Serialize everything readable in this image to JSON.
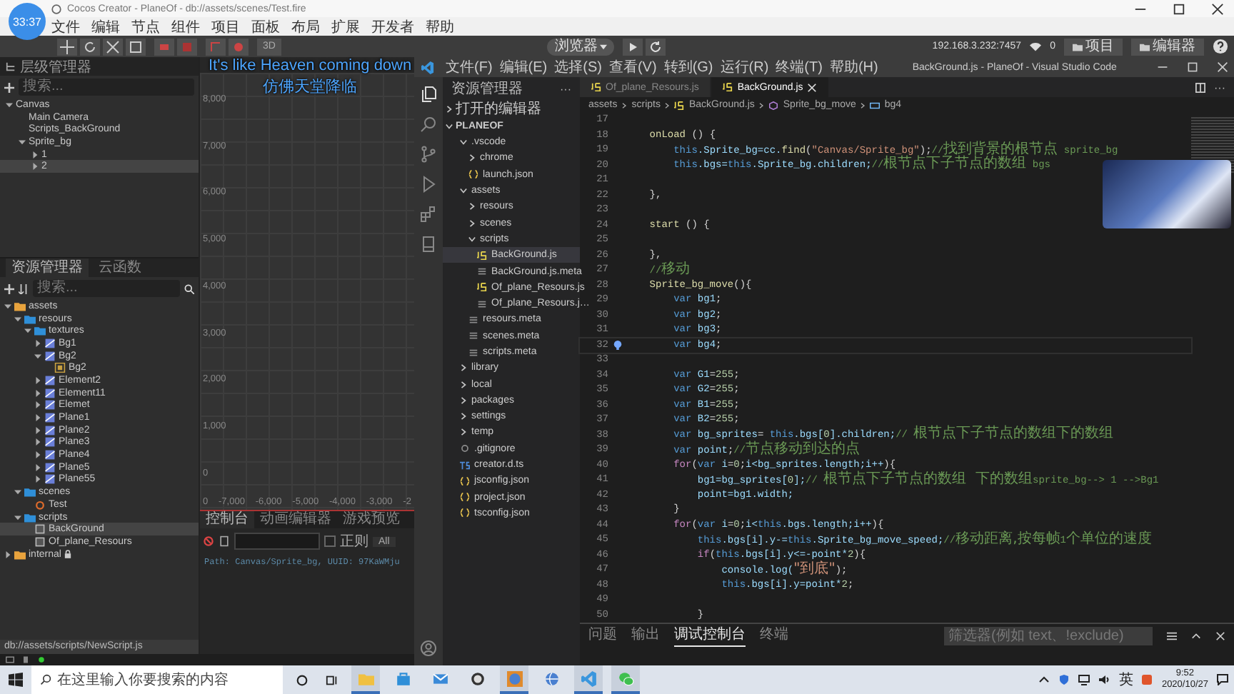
{
  "cocos": {
    "title": "Cocos Creator - PlaneOf - db://assets/scenes/Test.fire",
    "menu": [
      "文件",
      "编辑",
      "节点",
      "组件",
      "项目",
      "面板",
      "布局",
      "扩展",
      "开发者",
      "帮助"
    ],
    "timer": "33:37",
    "toolbar": {
      "mode": "3D",
      "platform": "浏览器",
      "ip": "192.168.3.232:7457",
      "clients": "0",
      "buttons": [
        "项目",
        "编辑器"
      ]
    },
    "hierarchy": {
      "title": "层级管理器",
      "search": {
        "placeholder": "搜索..."
      },
      "items": [
        {
          "name": "Canvas",
          "expanded": true,
          "selected": false,
          "children": [
            {
              "name": "Main Camera",
              "selected": false
            },
            {
              "name": "Scripts_BackGround",
              "selected": false
            },
            {
              "name": "Sprite_bg",
              "expanded": true,
              "selected": false,
              "children": [
                {
                  "name": "1",
                  "expanded": false,
                  "selected": false
                },
                {
                  "name": "2",
                  "expanded": false,
                  "selected": true
                }
              ]
            }
          ]
        }
      ]
    },
    "assets": {
      "tabs": [
        {
          "label": "资源管理器",
          "selected": true
        },
        {
          "label": "云函数",
          "selected": false
        }
      ],
      "search": {
        "placeholder": "搜索..."
      },
      "items": [
        {
          "name": "assets",
          "kind": "db",
          "expanded": true,
          "selected": false,
          "children": [
            {
              "name": "resours",
              "kind": "folder",
              "expanded": true,
              "selected": false,
              "children": [
                {
                  "name": "textures",
                  "kind": "folder",
                  "expanded": true,
                  "selected": false,
                  "children": [
                    {
                      "name": "Bg1",
                      "kind": "image",
                      "expanded": false,
                      "selected": false
                    },
                    {
                      "name": "Bg2",
                      "kind": "image",
                      "expanded": true,
                      "selected": false,
                      "children": [
                        {
                          "name": "Bg2",
                          "kind": "sprite",
                          "selected": false
                        }
                      ]
                    },
                    {
                      "name": "Element2",
                      "kind": "image",
                      "expanded": false,
                      "selected": false
                    },
                    {
                      "name": "Element11",
                      "kind": "image",
                      "expanded": false,
                      "selected": false
                    },
                    {
                      "name": "Elemet",
                      "kind": "image",
                      "expanded": false,
                      "selected": false
                    },
                    {
                      "name": "Plane1",
                      "kind": "image",
                      "expanded": false,
                      "selected": false
                    },
                    {
                      "name": "Plane2",
                      "kind": "image",
                      "expanded": false,
                      "selected": false
                    },
                    {
                      "name": "Plane3",
                      "kind": "image",
                      "expanded": false,
                      "selected": false
                    },
                    {
                      "name": "Plane4",
                      "kind": "image",
                      "expanded": false,
                      "selected": false
                    },
                    {
                      "name": "Plane5",
                      "kind": "image",
                      "expanded": false,
                      "selected": false
                    },
                    {
                      "name": "Plane55",
                      "kind": "image",
                      "expanded": false,
                      "selected": false
                    }
                  ]
                }
              ]
            },
            {
              "name": "scenes",
              "kind": "folder",
              "expanded": true,
              "selected": false,
              "children": [
                {
                  "name": "Test",
                  "kind": "scene",
                  "selected": false
                }
              ]
            },
            {
              "name": "scripts",
              "kind": "folder",
              "expanded": true,
              "selected": false,
              "children": [
                {
                  "name": "BackGround",
                  "kind": "script",
                  "selected": true
                },
                {
                  "name": "Of_plane_Resours",
                  "kind": "script",
                  "selected": false
                }
              ]
            }
          ]
        },
        {
          "name": "internal",
          "kind": "db",
          "expanded": false,
          "selected": false,
          "locked": true
        }
      ]
    },
    "scene": {
      "y_labels": [
        "8,000",
        "7,000",
        "6,000",
        "5,000",
        "4,000",
        "3,000",
        "2,000",
        "1,000",
        "0"
      ],
      "x_labels": [
        "0",
        "-7,000",
        "-6,000",
        "-5,000",
        "-4,000",
        "-3,000",
        "-2"
      ]
    },
    "console": {
      "tabs": [
        {
          "label": "控制台",
          "selected": true
        },
        {
          "label": "动画编辑器",
          "selected": false
        },
        {
          "label": "游戏预览",
          "selected": false
        }
      ],
      "regex": {
        "label": "正则",
        "checked": false
      },
      "level": "All",
      "log": "Path: Canvas/Sprite_bg, UUID: 97KaWMju"
    },
    "path_bar": "db://assets/scripts/NewScript.js"
  },
  "lyrics": [
    "It's like Heaven coming down",
    "仿佛天堂降临"
  ],
  "vscode": {
    "menu": [
      "文件(F)",
      "编辑(E)",
      "选择(S)",
      "查看(V)",
      "转到(G)",
      "运行(R)",
      "终端(T)",
      "帮助(H)"
    ],
    "title": "BackGround.js - PlaneOf - Visual Studio Code",
    "explorer": {
      "title": "资源管理器",
      "more": "···",
      "open_editors": "打开的编辑器",
      "project": "PLANEOF",
      "items": [
        {
          "name": ".vscode",
          "kind": "folder",
          "expanded": true,
          "selected": false,
          "children": [
            {
              "name": "chrome",
              "kind": "folder",
              "expanded": false,
              "selected": false
            },
            {
              "name": "launch.json",
              "kind": "json",
              "selected": false
            }
          ]
        },
        {
          "name": "assets",
          "kind": "folder",
          "expanded": true,
          "selected": false,
          "children": [
            {
              "name": "resours",
              "kind": "folder",
              "expanded": false,
              "selected": false
            },
            {
              "name": "scenes",
              "kind": "folder",
              "expanded": false,
              "selected": false
            },
            {
              "name": "scripts",
              "kind": "folder",
              "expanded": true,
              "selected": false,
              "children": [
                {
                  "name": "BackGround.js",
                  "kind": "js",
                  "selected": true
                },
                {
                  "name": "BackGround.js.meta",
                  "kind": "meta",
                  "selected": false
                },
                {
                  "name": "Of_plane_Resours.js",
                  "kind": "js",
                  "selected": false
                },
                {
                  "name": "Of_plane_Resours.j…",
                  "kind": "meta",
                  "selected": false
                }
              ]
            },
            {
              "name": "resours.meta",
              "kind": "meta",
              "selected": false
            },
            {
              "name": "scenes.meta",
              "kind": "meta",
              "selected": false
            },
            {
              "name": "scripts.meta",
              "kind": "meta",
              "selected": false
            }
          ]
        },
        {
          "name": "library",
          "kind": "folder",
          "expanded": false,
          "selected": false
        },
        {
          "name": "local",
          "kind": "folder",
          "expanded": false,
          "selected": false
        },
        {
          "name": "packages",
          "kind": "folder",
          "expanded": false,
          "selected": false
        },
        {
          "name": "settings",
          "kind": "folder",
          "expanded": false,
          "selected": false
        },
        {
          "name": "temp",
          "kind": "folder",
          "expanded": false,
          "selected": false
        },
        {
          "name": ".gitignore",
          "kind": "git",
          "selected": false
        },
        {
          "name": "creator.d.ts",
          "kind": "ts",
          "selected": false
        },
        {
          "name": "jsconfig.json",
          "kind": "json",
          "selected": false
        },
        {
          "name": "project.json",
          "kind": "json",
          "selected": false
        },
        {
          "name": "tsconfig.json",
          "kind": "json",
          "selected": false
        }
      ]
    },
    "tabs": [
      {
        "label": "Of_plane_Resours.js",
        "selected": false
      },
      {
        "label": "BackGround.js",
        "selected": true
      }
    ],
    "breadcrumbs": [
      {
        "kind": "folder",
        "text": "assets"
      },
      {
        "kind": "folder",
        "text": "scripts"
      },
      {
        "kind": "js",
        "text": "BackGround.js"
      },
      {
        "kind": "method",
        "text": "Sprite_bg_move"
      },
      {
        "kind": "variable",
        "text": "bg4"
      }
    ],
    "lines": [
      {
        "no": "17"
      },
      {
        "no": "18",
        "code": [
          {
            "kind": "fn",
            "text": "    onLoad"
          },
          {
            "kind": "tx",
            "text": " () {"
          }
        ]
      },
      {
        "no": "19",
        "code": [
          {
            "kind": "kw",
            "text": "        this"
          },
          {
            "kind": "id",
            "text": ".Sprite_bg=cc."
          },
          {
            "kind": "fn",
            "text": "find"
          },
          {
            "kind": "tx",
            "text": "("
          },
          {
            "kind": "str",
            "text": "\"Canvas/Sprite_bg\""
          },
          {
            "kind": "tx",
            "text": ");"
          },
          {
            "kind": "cm",
            "text": "//"
          },
          {
            "kind": "cmh",
            "text": "找到背景的根节点"
          },
          {
            "kind": "cm",
            "text": " sprite_bg"
          }
        ]
      },
      {
        "no": "20",
        "code": [
          {
            "kind": "kw",
            "text": "        this"
          },
          {
            "kind": "id",
            "text": ".bgs="
          },
          {
            "kind": "kw",
            "text": "this"
          },
          {
            "kind": "id",
            "text": ".Sprite_bg.children;"
          },
          {
            "kind": "cm",
            "text": "//"
          },
          {
            "kind": "cmh",
            "text": "根节点下子节点的数组"
          },
          {
            "kind": "cm",
            "text": " bgs"
          }
        ]
      },
      {
        "no": "21"
      },
      {
        "no": "22",
        "code": [
          {
            "kind": "tx",
            "text": "    },"
          }
        ]
      },
      {
        "no": "23"
      },
      {
        "no": "24",
        "code": [
          {
            "kind": "fn",
            "text": "    start"
          },
          {
            "kind": "tx",
            "text": " () {"
          }
        ]
      },
      {
        "no": "25"
      },
      {
        "no": "26",
        "code": [
          {
            "kind": "tx",
            "text": "    },"
          }
        ]
      },
      {
        "no": "27",
        "code": [
          {
            "kind": "cm",
            "text": "    //"
          },
          {
            "kind": "cmh",
            "text": "移动"
          }
        ]
      },
      {
        "no": "28",
        "code": [
          {
            "kind": "fn",
            "text": "    Sprite_bg_move"
          },
          {
            "kind": "tx",
            "text": "(){"
          }
        ]
      },
      {
        "no": "29",
        "code": [
          {
            "kind": "kw",
            "text": "        var"
          },
          {
            "kind": "id",
            "text": " bg1"
          },
          {
            "kind": "tx",
            "text": ";"
          }
        ]
      },
      {
        "no": "30",
        "code": [
          {
            "kind": "kw",
            "text": "        var"
          },
          {
            "kind": "id",
            "text": " bg2"
          },
          {
            "kind": "tx",
            "text": ";"
          }
        ]
      },
      {
        "no": "31",
        "code": [
          {
            "kind": "kw",
            "text": "        var"
          },
          {
            "kind": "id",
            "text": " bg3"
          },
          {
            "kind": "tx",
            "text": ";"
          }
        ]
      },
      {
        "no": "32",
        "current": true,
        "code": [
          {
            "kind": "kw",
            "text": "        var"
          },
          {
            "kind": "id",
            "text": " bg4"
          },
          {
            "kind": "tx",
            "text": ";"
          }
        ]
      },
      {
        "no": "33"
      },
      {
        "no": "34",
        "code": [
          {
            "kind": "kw",
            "text": "        var"
          },
          {
            "kind": "id",
            "text": " G1"
          },
          {
            "kind": "tx",
            "text": "="
          },
          {
            "kind": "num",
            "text": "255"
          },
          {
            "kind": "tx",
            "text": ";"
          }
        ]
      },
      {
        "no": "35",
        "code": [
          {
            "kind": "kw",
            "text": "        var"
          },
          {
            "kind": "id",
            "text": " G2"
          },
          {
            "kind": "tx",
            "text": "="
          },
          {
            "kind": "num",
            "text": "255"
          },
          {
            "kind": "tx",
            "text": ";"
          }
        ]
      },
      {
        "no": "36",
        "code": [
          {
            "kind": "kw",
            "text": "        var"
          },
          {
            "kind": "id",
            "text": " B1"
          },
          {
            "kind": "tx",
            "text": "="
          },
          {
            "kind": "num",
            "text": "255"
          },
          {
            "kind": "tx",
            "text": ";"
          }
        ]
      },
      {
        "no": "37",
        "code": [
          {
            "kind": "kw",
            "text": "        var"
          },
          {
            "kind": "id",
            "text": " B2"
          },
          {
            "kind": "tx",
            "text": "="
          },
          {
            "kind": "num",
            "text": "255"
          },
          {
            "kind": "tx",
            "text": ";"
          }
        ]
      },
      {
        "no": "38",
        "code": [
          {
            "kind": "kw",
            "text": "        var"
          },
          {
            "kind": "id",
            "text": " bg_sprites"
          },
          {
            "kind": "tx",
            "text": "= "
          },
          {
            "kind": "kw",
            "text": "this"
          },
          {
            "kind": "id",
            "text": ".bgs["
          },
          {
            "kind": "num",
            "text": "0"
          },
          {
            "kind": "id",
            "text": "].children;"
          },
          {
            "kind": "cm",
            "text": "// "
          },
          {
            "kind": "cmh",
            "text": "根节点下子节点的数组下的数组"
          }
        ]
      },
      {
        "no": "39",
        "code": [
          {
            "kind": "kw",
            "text": "        var"
          },
          {
            "kind": "id",
            "text": " point"
          },
          {
            "kind": "tx",
            "text": ";"
          },
          {
            "kind": "cm",
            "text": "//"
          },
          {
            "kind": "cmh",
            "text": "节点移动到达的点"
          }
        ]
      },
      {
        "no": "40",
        "code": [
          {
            "kind": "ctl",
            "text": "        for"
          },
          {
            "kind": "tx",
            "text": "("
          },
          {
            "kind": "kw",
            "text": "var"
          },
          {
            "kind": "id",
            "text": " i"
          },
          {
            "kind": "tx",
            "text": "="
          },
          {
            "kind": "num",
            "text": "0"
          },
          {
            "kind": "tx",
            "text": ";"
          },
          {
            "kind": "id",
            "text": "i<bg_sprites.length;i++"
          },
          {
            "kind": "tx",
            "text": "){"
          }
        ]
      },
      {
        "no": "41",
        "code": [
          {
            "kind": "id",
            "text": "            bg1=bg_sprites["
          },
          {
            "kind": "num",
            "text": "0"
          },
          {
            "kind": "id",
            "text": "];"
          },
          {
            "kind": "cm",
            "text": "// "
          },
          {
            "kind": "cmh",
            "text": "根节点下子节点的数组  下的数组"
          },
          {
            "kind": "cm",
            "text": "sprite_bg--> 1 -->Bg1"
          }
        ]
      },
      {
        "no": "42",
        "code": [
          {
            "kind": "id",
            "text": "            point=bg1.width;"
          }
        ]
      },
      {
        "no": "43",
        "code": [
          {
            "kind": "tx",
            "text": "        }"
          }
        ]
      },
      {
        "no": "44",
        "code": [
          {
            "kind": "ctl",
            "text": "        for"
          },
          {
            "kind": "tx",
            "text": "("
          },
          {
            "kind": "kw",
            "text": "var"
          },
          {
            "kind": "id",
            "text": " i"
          },
          {
            "kind": "tx",
            "text": "="
          },
          {
            "kind": "num",
            "text": "0"
          },
          {
            "kind": "tx",
            "text": ";"
          },
          {
            "kind": "id",
            "text": "i<"
          },
          {
            "kind": "kw",
            "text": "this"
          },
          {
            "kind": "id",
            "text": ".bgs.length;i++"
          },
          {
            "kind": "tx",
            "text": "){"
          }
        ]
      },
      {
        "no": "45",
        "code": [
          {
            "kind": "kw",
            "text": "            this"
          },
          {
            "kind": "id",
            "text": ".bgs[i].y-="
          },
          {
            "kind": "kw",
            "text": "this"
          },
          {
            "kind": "id",
            "text": ".Sprite_bg_move_speed;"
          },
          {
            "kind": "cm",
            "text": "//"
          },
          {
            "kind": "cmh",
            "text": "移动距离,按每帧"
          },
          {
            "kind": "cm",
            "text": "1"
          },
          {
            "kind": "cmh",
            "text": "个单位的速度"
          }
        ]
      },
      {
        "no": "46",
        "code": [
          {
            "kind": "ctl",
            "text": "            if"
          },
          {
            "kind": "tx",
            "text": "("
          },
          {
            "kind": "kw",
            "text": "this"
          },
          {
            "kind": "id",
            "text": ".bgs[i].y<=-point*"
          },
          {
            "kind": "num",
            "text": "2"
          },
          {
            "kind": "tx",
            "text": "){"
          }
        ]
      },
      {
        "no": "47",
        "code": [
          {
            "kind": "id",
            "text": "                console.log("
          },
          {
            "kind": "strh",
            "text": "\"到底\""
          },
          {
            "kind": "tx",
            "text": ");"
          }
        ]
      },
      {
        "no": "48",
        "code": [
          {
            "kind": "kw",
            "text": "                this"
          },
          {
            "kind": "id",
            "text": ".bgs[i].y=point*"
          },
          {
            "kind": "num",
            "text": "2"
          },
          {
            "kind": "tx",
            "text": ";"
          }
        ]
      },
      {
        "no": "49"
      },
      {
        "no": "50",
        "code": [
          {
            "kind": "tx",
            "text": "            }"
          }
        ]
      }
    ],
    "panel": {
      "tabs": [
        {
          "label": "问题",
          "selected": false
        },
        {
          "label": "输出",
          "selected": false
        },
        {
          "label": "调试控制台",
          "selected": true
        },
        {
          "label": "终端",
          "selected": false
        }
      ],
      "filter": {
        "placeholder": "筛选器(例如 text、!exclude)"
      }
    }
  },
  "taskbar": {
    "search": {
      "placeholder": "在这里输入你要搜索的内容"
    },
    "apps": [
      {
        "kind": "folder",
        "active": true
      },
      {
        "kind": "store",
        "active": false
      },
      {
        "kind": "mail",
        "active": false
      },
      {
        "kind": "clock",
        "active": false
      },
      {
        "kind": "chrome",
        "active": true
      },
      {
        "kind": "globe",
        "active": false
      },
      {
        "kind": "vscode",
        "active": true
      },
      {
        "kind": "wechat",
        "active": true
      }
    ],
    "ime": "英",
    "time": "9:52",
    "date": "2020/10/27"
  }
}
